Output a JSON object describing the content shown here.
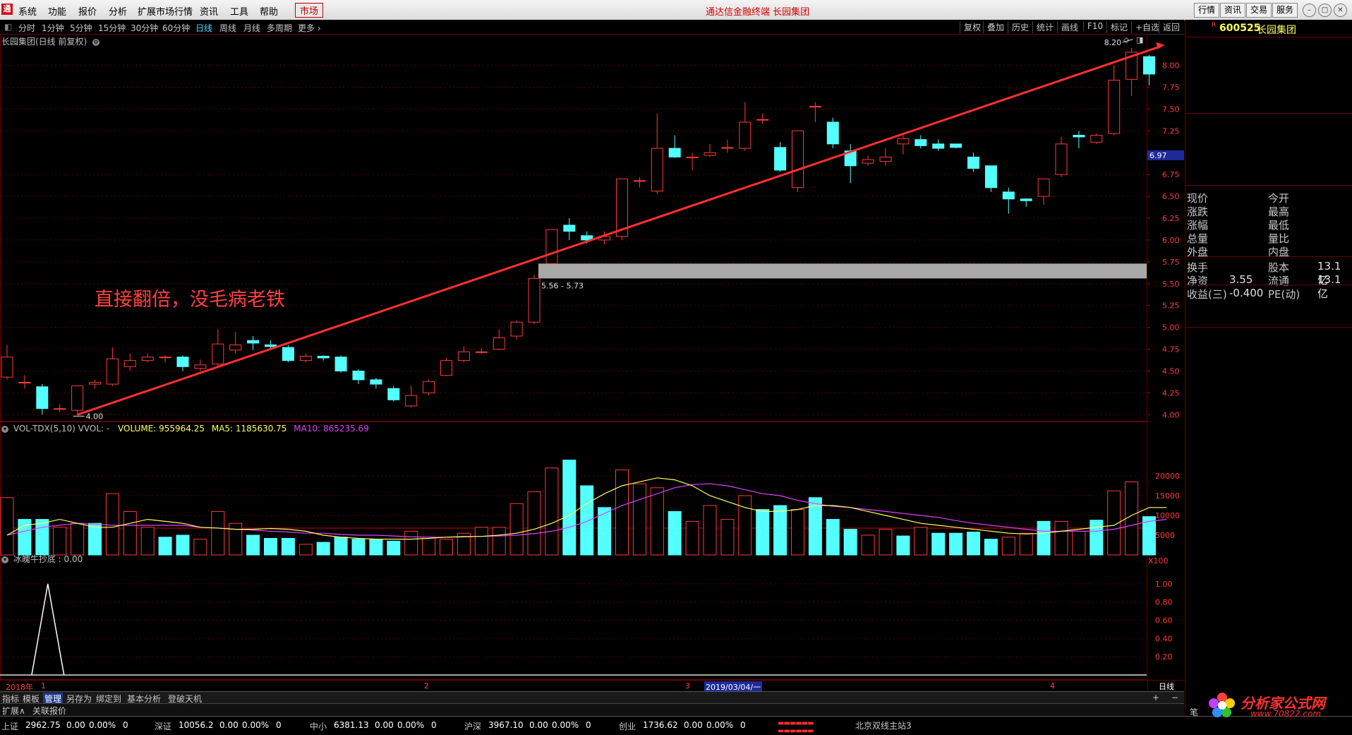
{
  "menu": {
    "items": [
      "系统",
      "功能",
      "报价",
      "分析",
      "扩展市场行情",
      "资讯",
      "工具",
      "帮助"
    ],
    "active": "市场",
    "title": "通达信金融终端 长园集团",
    "right_buttons": [
      "行情",
      "资讯",
      "交易",
      "服务"
    ]
  },
  "periods": [
    "分时",
    "1分钟",
    "5分钟",
    "15分钟",
    "30分钟",
    "60分钟",
    "日线",
    "周线",
    "月线",
    "多周期",
    "更多"
  ],
  "selected_period": "日线",
  "right_tools": [
    "复权",
    "叠加",
    "历史",
    "统计",
    "画线",
    "F10",
    "标记",
    "+自选",
    "返回"
  ],
  "price_panel": {
    "title": "长园集团(日线 前复权)",
    "annotation": "直接翻倍，没毛病老铁",
    "high_label": "8.20",
    "low_label": "4.00",
    "zone_label": "5.56 - 5.73",
    "current_marker": "6.97",
    "y_ticks": [
      "8.00",
      "7.75",
      "7.50",
      "7.25",
      "6.75",
      "6.50",
      "6.25",
      "6.00",
      "5.75",
      "5.50",
      "5.25",
      "5.00",
      "4.75",
      "4.50",
      "4.25",
      "4.00"
    ]
  },
  "volume_panel": {
    "title": "VOL-TDX(5,10) VVOL: -",
    "volume_text": "VOLUME: 955964.25",
    "ma5_text": "MA5: 1185630.75",
    "ma10_text": "MA10: 865235.69",
    "y_ticks": [
      "20000",
      "15000",
      "10000",
      "5000"
    ],
    "unit": "X100"
  },
  "indicator_panel": {
    "title": "冰魄牛抄底 : 0.00",
    "y_ticks": [
      "1.00",
      "0.80",
      "0.60",
      "0.40",
      "0.20"
    ]
  },
  "date_axis": {
    "year": "2018年",
    "months": [
      "1",
      "2",
      "3",
      "4"
    ],
    "highlight": "2019/03/04/一",
    "period": "日线"
  },
  "bottom_tabs": [
    "指标",
    "模板",
    "管理",
    "另存为",
    "绑定到",
    "基本分析",
    "登破天机"
  ],
  "ext_tabs": [
    "扩展∧",
    "关联报价"
  ],
  "stock": {
    "flag": "R",
    "code": "600525",
    "name": "长园集团"
  },
  "quote_rows": [
    [
      "现价",
      "",
      "今开",
      ""
    ],
    [
      "涨跌",
      "",
      "最高",
      ""
    ],
    [
      "涨幅",
      "",
      "最低",
      ""
    ],
    [
      "总量",
      "",
      "量比",
      ""
    ],
    [
      "外盘",
      "",
      "内盘",
      ""
    ]
  ],
  "fund_rows": [
    [
      "换手",
      "",
      "股本",
      "13.1亿"
    ],
    [
      "净资",
      "3.55",
      "流通",
      "13.1亿"
    ],
    [
      "收益(三)",
      "-0.400",
      "PE(动)",
      ""
    ]
  ],
  "status": [
    {
      "name": "上证",
      "price": "2962.75",
      "chg": "0.00",
      "pct": "0.00%",
      "vol": "0"
    },
    {
      "name": "深证",
      "price": "10056.2",
      "chg": "0.00",
      "pct": "0.00%",
      "vol": "0"
    },
    {
      "name": "中小",
      "price": "6381.13",
      "chg": "0.00",
      "pct": "0.00%",
      "vol": "0"
    },
    {
      "name": "沪深",
      "price": "3967.10",
      "chg": "0.00",
      "pct": "0.00%",
      "vol": "0"
    },
    {
      "name": "创业",
      "price": "1736.62",
      "chg": "0.00",
      "pct": "0.00%",
      "vol": "0"
    }
  ],
  "server": "北京双线主站3",
  "pen_label": "笔",
  "watermark": {
    "title": "分析家公式网",
    "url": "www.70822.com"
  },
  "colors": {
    "up": "#ff3a3a",
    "down": "#54ffff",
    "ma5": "#ffff60",
    "ma10": "#e040ff",
    "trend": "#ff3030"
  },
  "chart_data": {
    "type": "candlestick",
    "candles": [
      [
        4.43,
        4.66,
        4.8,
        4.4
      ],
      [
        4.37,
        4.37,
        4.45,
        4.3
      ],
      [
        4.32,
        4.07,
        4.35,
        4.0
      ],
      [
        4.07,
        4.07,
        4.12,
        4.03
      ],
      [
        4.05,
        4.33,
        4.33,
        4.0
      ],
      [
        4.35,
        4.37,
        4.4,
        4.3
      ],
      [
        4.35,
        4.64,
        4.77,
        4.33
      ],
      [
        4.55,
        4.62,
        4.7,
        4.5
      ],
      [
        4.62,
        4.66,
        4.7,
        4.6
      ],
      [
        4.66,
        4.66,
        4.68,
        4.6
      ],
      [
        4.66,
        4.55,
        4.68,
        4.5
      ],
      [
        4.53,
        4.57,
        4.63,
        4.5
      ],
      [
        4.58,
        4.81,
        4.98,
        4.55
      ],
      [
        4.74,
        4.8,
        4.95,
        4.7
      ],
      [
        4.85,
        4.82,
        4.9,
        4.74
      ],
      [
        4.8,
        4.78,
        4.85,
        4.75
      ],
      [
        4.77,
        4.62,
        4.8,
        4.6
      ],
      [
        4.62,
        4.67,
        4.7,
        4.6
      ],
      [
        4.67,
        4.65,
        4.68,
        4.62
      ],
      [
        4.66,
        4.5,
        4.68,
        4.48
      ],
      [
        4.5,
        4.4,
        4.52,
        4.35
      ],
      [
        4.4,
        4.35,
        4.42,
        4.3
      ],
      [
        4.3,
        4.17,
        4.33,
        4.15
      ],
      [
        4.1,
        4.22,
        4.33,
        4.08
      ],
      [
        4.25,
        4.38,
        4.4,
        4.22
      ],
      [
        4.45,
        4.62,
        4.65,
        4.44
      ],
      [
        4.62,
        4.72,
        4.78,
        4.6
      ],
      [
        4.72,
        4.72,
        4.76,
        4.7
      ],
      [
        4.75,
        4.88,
        4.98,
        4.74
      ],
      [
        4.9,
        5.06,
        5.08,
        4.86
      ],
      [
        5.06,
        5.56,
        5.6,
        5.04
      ],
      [
        5.73,
        6.12,
        6.12,
        5.73
      ],
      [
        6.17,
        6.1,
        6.25,
        6.0
      ],
      [
        6.05,
        6.0,
        6.1,
        5.96
      ],
      [
        6.0,
        6.04,
        6.1,
        5.95
      ],
      [
        6.04,
        6.7,
        6.7,
        6.0
      ],
      [
        6.68,
        6.68,
        6.72,
        6.6
      ],
      [
        6.56,
        7.05,
        7.45,
        6.53
      ],
      [
        7.05,
        6.95,
        7.2,
        6.94
      ],
      [
        6.94,
        6.95,
        7.0,
        6.8
      ],
      [
        6.97,
        7.0,
        7.1,
        6.95
      ],
      [
        7.05,
        7.06,
        7.15,
        7.0
      ],
      [
        7.05,
        7.35,
        7.58,
        7.02
      ],
      [
        7.38,
        7.38,
        7.45,
        7.33
      ],
      [
        7.06,
        6.8,
        7.12,
        6.78
      ],
      [
        6.6,
        7.25,
        7.25,
        6.55
      ],
      [
        7.53,
        7.53,
        7.58,
        7.35
      ],
      [
        7.35,
        7.1,
        7.4,
        7.05
      ],
      [
        7.02,
        6.85,
        7.1,
        6.65
      ],
      [
        6.88,
        6.92,
        6.97,
        6.85
      ],
      [
        6.9,
        6.95,
        7.05,
        6.85
      ],
      [
        7.1,
        7.16,
        7.2,
        6.98
      ],
      [
        7.15,
        7.08,
        7.2,
        7.05
      ],
      [
        7.1,
        7.05,
        7.15,
        7.02
      ],
      [
        7.1,
        7.06,
        7.1,
        7.05
      ],
      [
        6.95,
        6.82,
        7.0,
        6.78
      ],
      [
        6.85,
        6.6,
        6.85,
        6.55
      ],
      [
        6.55,
        6.47,
        6.6,
        6.3
      ],
      [
        6.47,
        6.45,
        6.48,
        6.38
      ],
      [
        6.5,
        6.7,
        6.7,
        6.4
      ],
      [
        6.75,
        7.1,
        7.18,
        6.72
      ],
      [
        7.2,
        7.18,
        7.25,
        7.05
      ],
      [
        7.12,
        7.2,
        7.22,
        7.1
      ],
      [
        7.22,
        7.83,
        8.0,
        7.2
      ],
      [
        7.84,
        8.15,
        8.2,
        7.65
      ],
      [
        8.1,
        7.9,
        8.12,
        7.77
      ]
    ],
    "volume": [
      [
        14500,
        "down"
      ],
      [
        9000,
        "up"
      ],
      [
        9000,
        "up"
      ],
      [
        7000,
        "down"
      ],
      [
        8000,
        "down"
      ],
      [
        8000,
        "up"
      ],
      [
        15500,
        "down"
      ],
      [
        11000,
        "down"
      ],
      [
        7000,
        "down"
      ],
      [
        4500,
        "up"
      ],
      [
        5000,
        "up"
      ],
      [
        4000,
        "down"
      ],
      [
        11000,
        "down"
      ],
      [
        8000,
        "down"
      ],
      [
        5000,
        "up"
      ],
      [
        4200,
        "up"
      ],
      [
        4200,
        "up"
      ],
      [
        2700,
        "down"
      ],
      [
        3200,
        "up"
      ],
      [
        4500,
        "up"
      ],
      [
        4000,
        "up"
      ],
      [
        4000,
        "up"
      ],
      [
        3500,
        "up"
      ],
      [
        6000,
        "down"
      ],
      [
        4500,
        "down"
      ],
      [
        4000,
        "down"
      ],
      [
        5500,
        "down"
      ],
      [
        7000,
        "down"
      ],
      [
        7000,
        "down"
      ],
      [
        13000,
        "down"
      ],
      [
        16000,
        "down"
      ],
      [
        22000,
        "down"
      ],
      [
        24000,
        "up"
      ],
      [
        17500,
        "up"
      ],
      [
        12000,
        "up"
      ],
      [
        21500,
        "down"
      ],
      [
        18000,
        "down"
      ],
      [
        17000,
        "down"
      ],
      [
        11000,
        "up"
      ],
      [
        8500,
        "down"
      ],
      [
        12500,
        "down"
      ],
      [
        9000,
        "down"
      ],
      [
        15000,
        "down"
      ],
      [
        11500,
        "up"
      ],
      [
        12500,
        "up"
      ],
      [
        11500,
        "down"
      ],
      [
        14500,
        "up"
      ],
      [
        9000,
        "up"
      ],
      [
        6500,
        "up"
      ],
      [
        5000,
        "down"
      ],
      [
        6500,
        "down"
      ],
      [
        4800,
        "up"
      ],
      [
        7000,
        "down"
      ],
      [
        5500,
        "up"
      ],
      [
        5500,
        "up"
      ],
      [
        5800,
        "up"
      ],
      [
        4000,
        "up"
      ],
      [
        4500,
        "down"
      ],
      [
        5500,
        "down"
      ],
      [
        8500,
        "up"
      ],
      [
        8500,
        "down"
      ],
      [
        6000,
        "down"
      ],
      [
        8800,
        "up"
      ],
      [
        16200,
        "down"
      ],
      [
        18500,
        "down"
      ],
      [
        9700,
        "up"
      ]
    ],
    "ma5": [
      5000,
      7500,
      8000,
      9000,
      8000,
      7000,
      7000,
      8000,
      9000,
      8500,
      8000,
      7000,
      6800,
      6500,
      6500,
      6700,
      6500,
      6000,
      5000,
      4500,
      4200,
      4000,
      4000,
      4000,
      4200,
      4500,
      4600,
      4700,
      5000,
      5500,
      6500,
      8000,
      10000,
      13000,
      15500,
      17500,
      18500,
      19500,
      19000,
      17500,
      15000,
      13500,
      12000,
      11000,
      11000,
      11500,
      12500,
      12500,
      12000,
      11000,
      10000,
      9000,
      8000,
      7500,
      7000,
      6500,
      6000,
      5500,
      5300,
      5500,
      6000,
      6500,
      7000,
      7500,
      10000,
      12000,
      12000
    ],
    "ma10": [
      5000,
      6000,
      7000,
      7500,
      8000,
      7800,
      7500,
      7500,
      7500,
      7500,
      7500,
      7000,
      6800,
      6500,
      6300,
      6000,
      5800,
      5500,
      5500,
      5200,
      5000,
      5000,
      4800,
      4600,
      4500,
      4500,
      4700,
      4700,
      4800,
      5000,
      5400,
      6000,
      7000,
      8500,
      10500,
      12500,
      14000,
      15500,
      17000,
      17800,
      18000,
      17500,
      16500,
      15500,
      15000,
      13800,
      13000,
      12300,
      12000,
      11500,
      11000,
      10500,
      10000,
      9500,
      8700,
      8000,
      7500,
      7000,
      6500,
      6000,
      6000,
      6000,
      6000,
      6500,
      7500,
      8500,
      9000
    ],
    "indicator": {
      "spike_index": 2,
      "spike_value": 1.0
    },
    "trend_line": {
      "from": [
        4,
        4.0
      ],
      "to": [
        65,
        8.2
      ]
    },
    "zone": {
      "low": 5.56,
      "high": 5.73
    },
    "price_ylim": [
      3.93,
      8.36
    ],
    "volume_ylim": [
      0,
      25000
    ],
    "indicator_ylim": [
      0,
      1.2
    ]
  }
}
